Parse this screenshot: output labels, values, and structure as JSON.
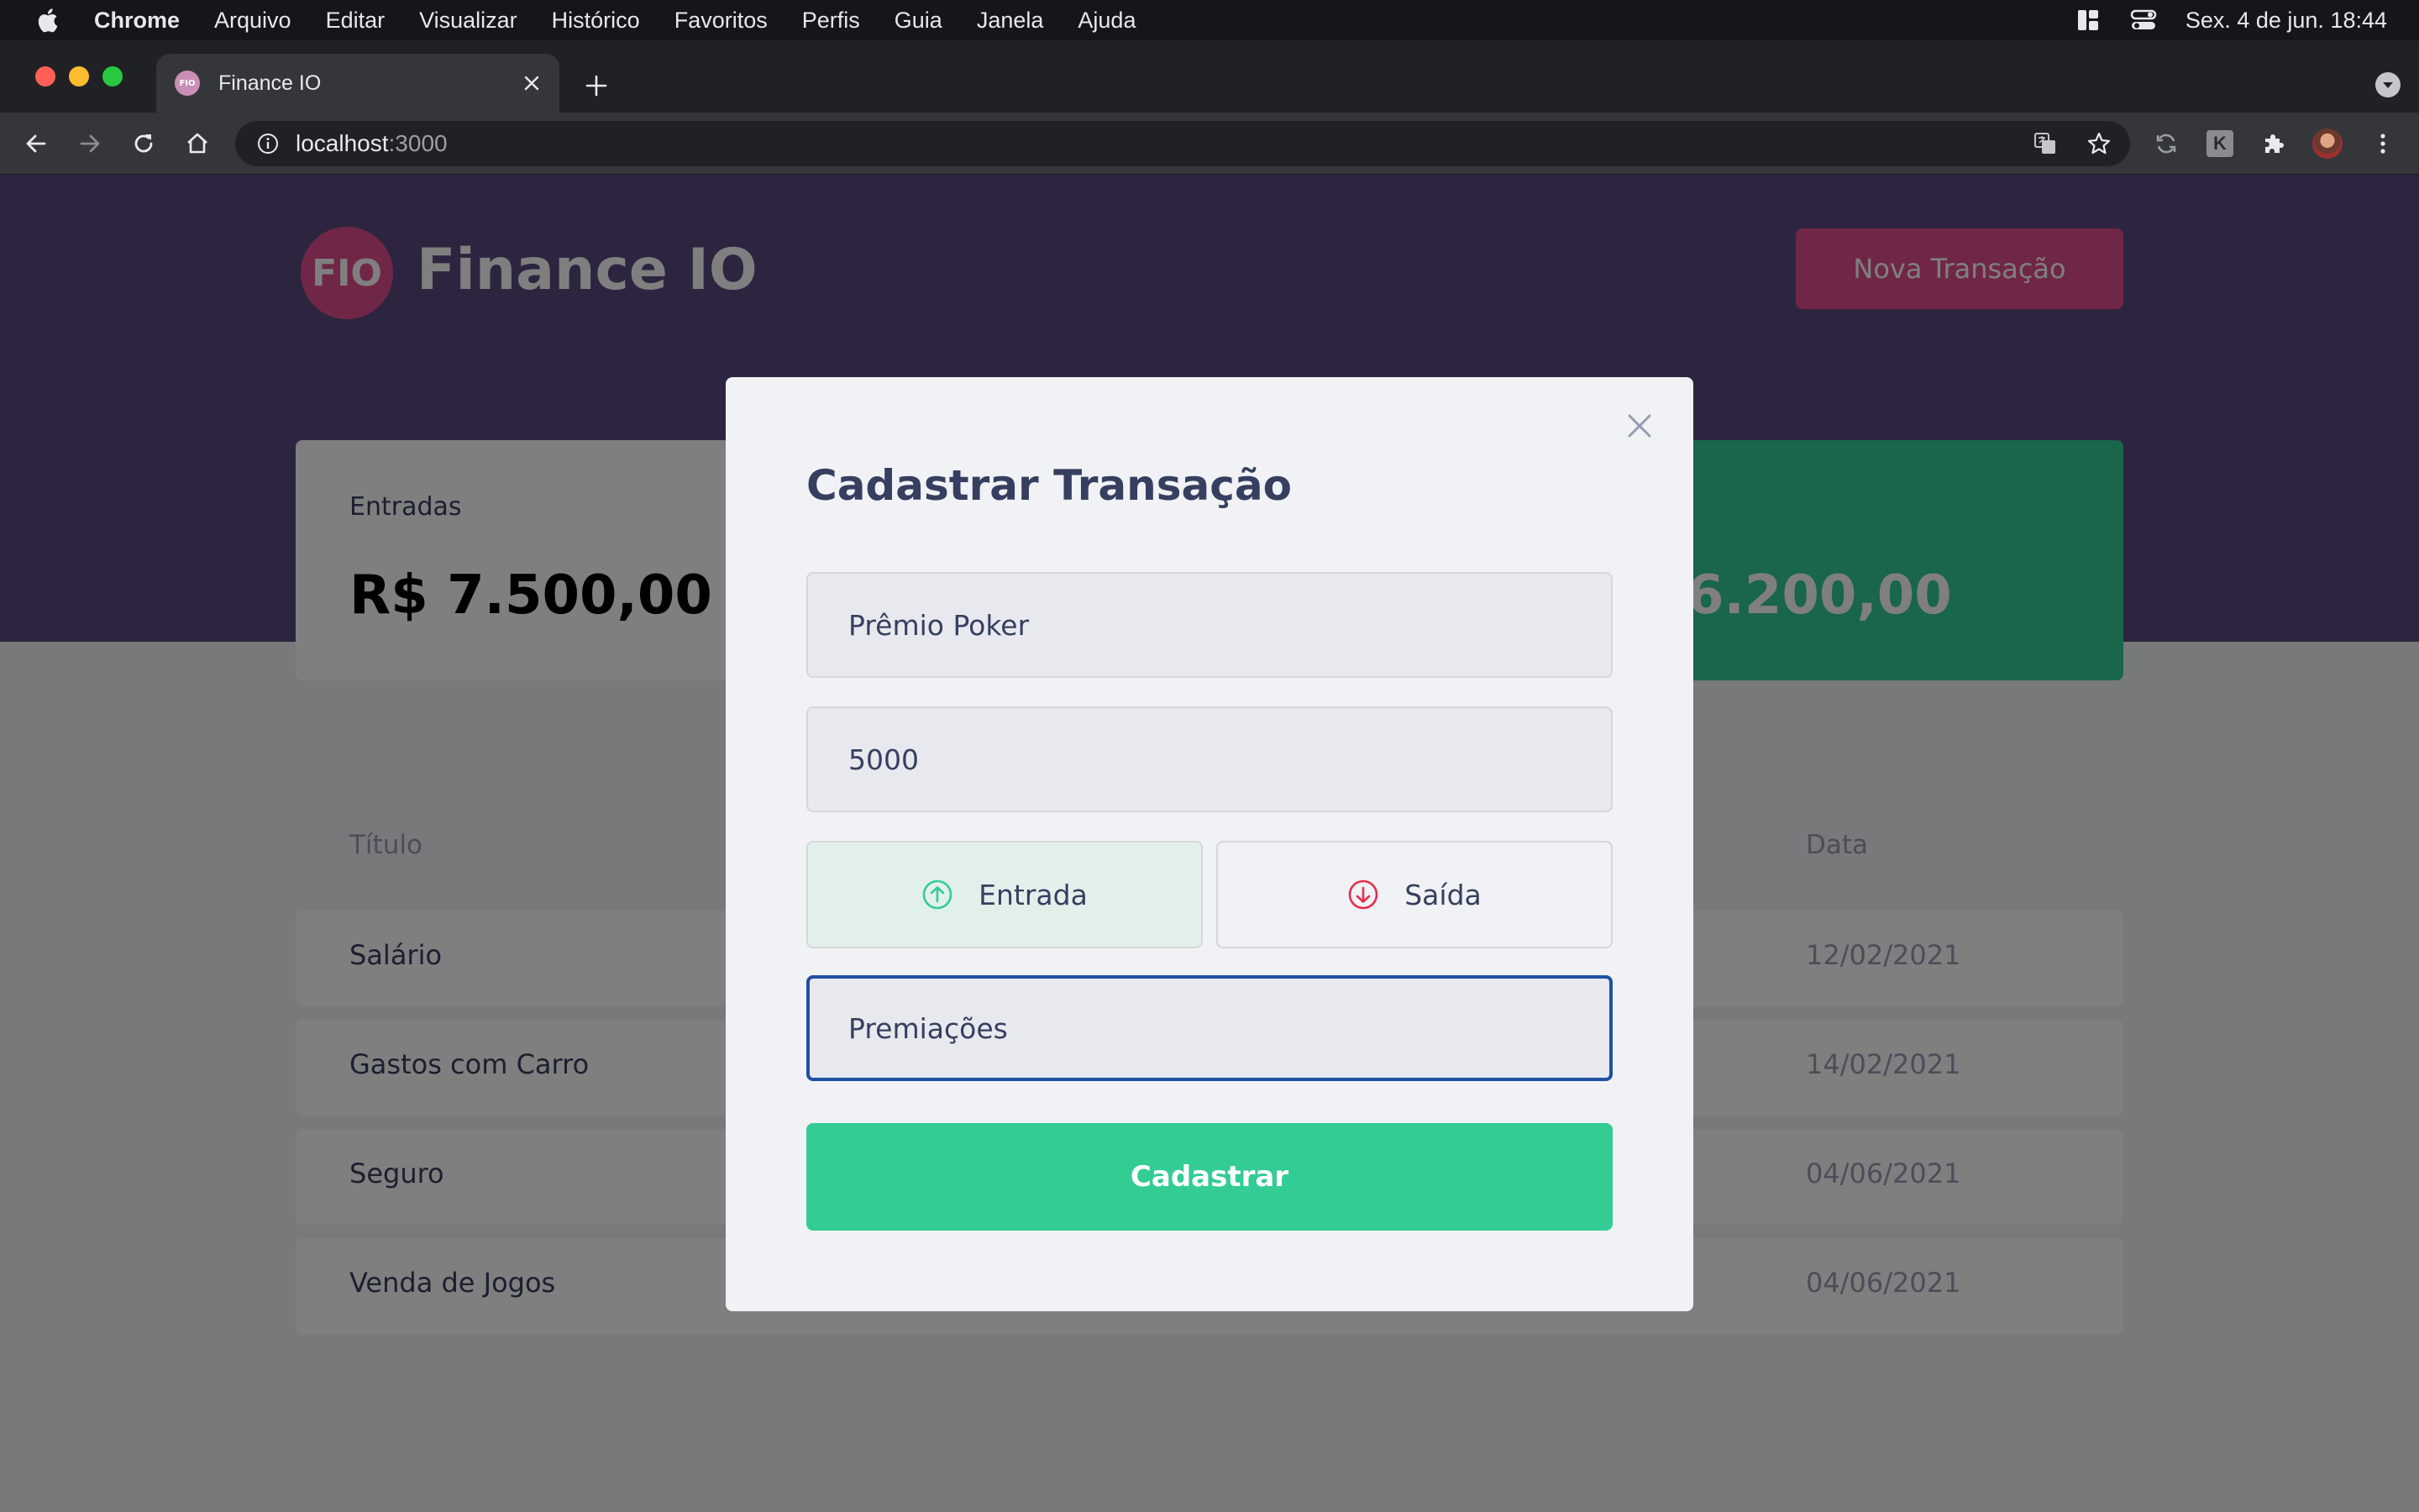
{
  "menubar": {
    "items": [
      "Chrome",
      "Arquivo",
      "Editar",
      "Visualizar",
      "Histórico",
      "Favoritos",
      "Perfis",
      "Guia",
      "Janela",
      "Ajuda"
    ],
    "clock": "Sex. 4 de jun.  18:44"
  },
  "browser": {
    "tab_title": "Finance IO",
    "favicon_text": "FIO",
    "url_host": "localhost",
    "url_port": ":3000",
    "extension_k": "K"
  },
  "app": {
    "logo_text": "FIO",
    "brand": "Finance IO",
    "new_transaction_label": "Nova Transação"
  },
  "summary": {
    "income_label": "Entradas",
    "income_value": "R$ 7.500,00",
    "total_value_partial": "6.200,00"
  },
  "table": {
    "headers": {
      "title": "Título",
      "date": "Data"
    },
    "rows": [
      {
        "title": "Salário",
        "date": "12/02/2021"
      },
      {
        "title": "Gastos com Carro",
        "date": "14/02/2021"
      },
      {
        "title": "Seguro",
        "date": "04/06/2021"
      },
      {
        "title": "Venda de Jogos",
        "date": "04/06/2021"
      }
    ]
  },
  "modal": {
    "title": "Cadastrar Transação",
    "title_field_value": "Prêmio Poker",
    "amount_field_value": "5000",
    "income_type_label": "Entrada",
    "outcome_type_label": "Saída",
    "category_field_value": "Premiações",
    "submit_label": "Cadastrar",
    "selected_type": "Entrada"
  },
  "colors": {
    "hero": "#5a4b81",
    "accent_pink": "#e04f8f",
    "green": "#33cc95",
    "red": "#e52e4d",
    "text": "#363f5f",
    "focus_border": "#1f50a3"
  },
  "icons": [
    "apple-icon",
    "close-icon",
    "plus-icon",
    "back-icon",
    "forward-icon",
    "reload-icon",
    "home-icon",
    "info-icon",
    "translate-icon",
    "star-icon",
    "sync-icon",
    "puzzle-icon",
    "kebab-icon",
    "arrow-up-circle-icon",
    "arrow-down-circle-icon"
  ]
}
